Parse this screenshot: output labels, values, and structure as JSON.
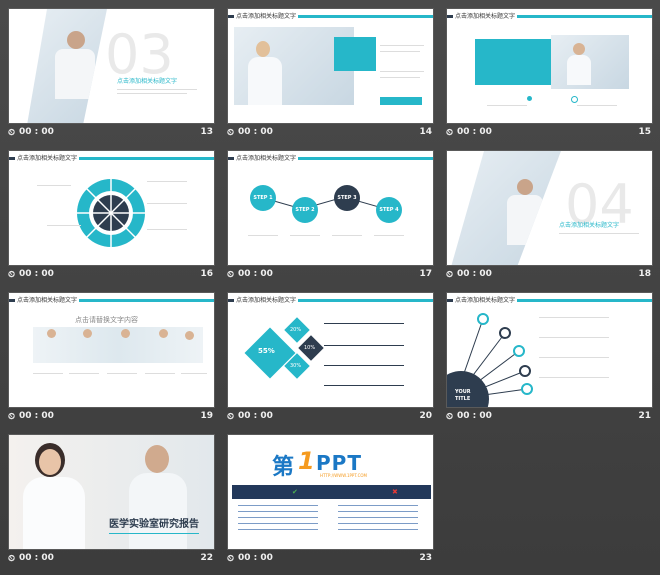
{
  "slides": [
    {
      "num": "13",
      "duration": "00 : 00",
      "heading": "点击添加相关标题文字",
      "big": "03"
    },
    {
      "num": "14",
      "duration": "00 : 00",
      "heading": "点击添加相关标题文字"
    },
    {
      "num": "15",
      "duration": "00 : 00",
      "heading": "点击添加相关标题文字"
    },
    {
      "num": "16",
      "duration": "00 : 00",
      "heading": "点击添加相关标题文字"
    },
    {
      "num": "17",
      "duration": "00 : 00",
      "heading": "点击添加相关标题文字",
      "steps": [
        "STEP 1",
        "STEP 2",
        "STEP 3",
        "STEP 4"
      ]
    },
    {
      "num": "18",
      "duration": "00 : 00",
      "heading": "点击添加相关标题文字",
      "big": "04"
    },
    {
      "num": "19",
      "duration": "00 : 00",
      "heading": "点击添加相关标题文字",
      "sub": "点击请替换文字内容"
    },
    {
      "num": "20",
      "duration": "00 : 00",
      "heading": "点击添加相关标题文字",
      "pcts": [
        "20%",
        "55%",
        "30%",
        "10%"
      ]
    },
    {
      "num": "21",
      "duration": "00 : 00",
      "heading": "点击添加相关标题文字",
      "your": "YOUR",
      "titlew": "TITLE"
    },
    {
      "num": "22",
      "duration": "00 : 00",
      "cover": "医学实验室研究报告"
    },
    {
      "num": "23",
      "duration": "00 : 00",
      "logo_a": "第",
      "logo_b": "1",
      "logo_c": "PPT",
      "site": "HTTP://WWW.1PPT.COM"
    }
  ],
  "colors": {
    "accent": "#26b7c9",
    "navy": "#2e3d4f",
    "bg": "#444444"
  }
}
